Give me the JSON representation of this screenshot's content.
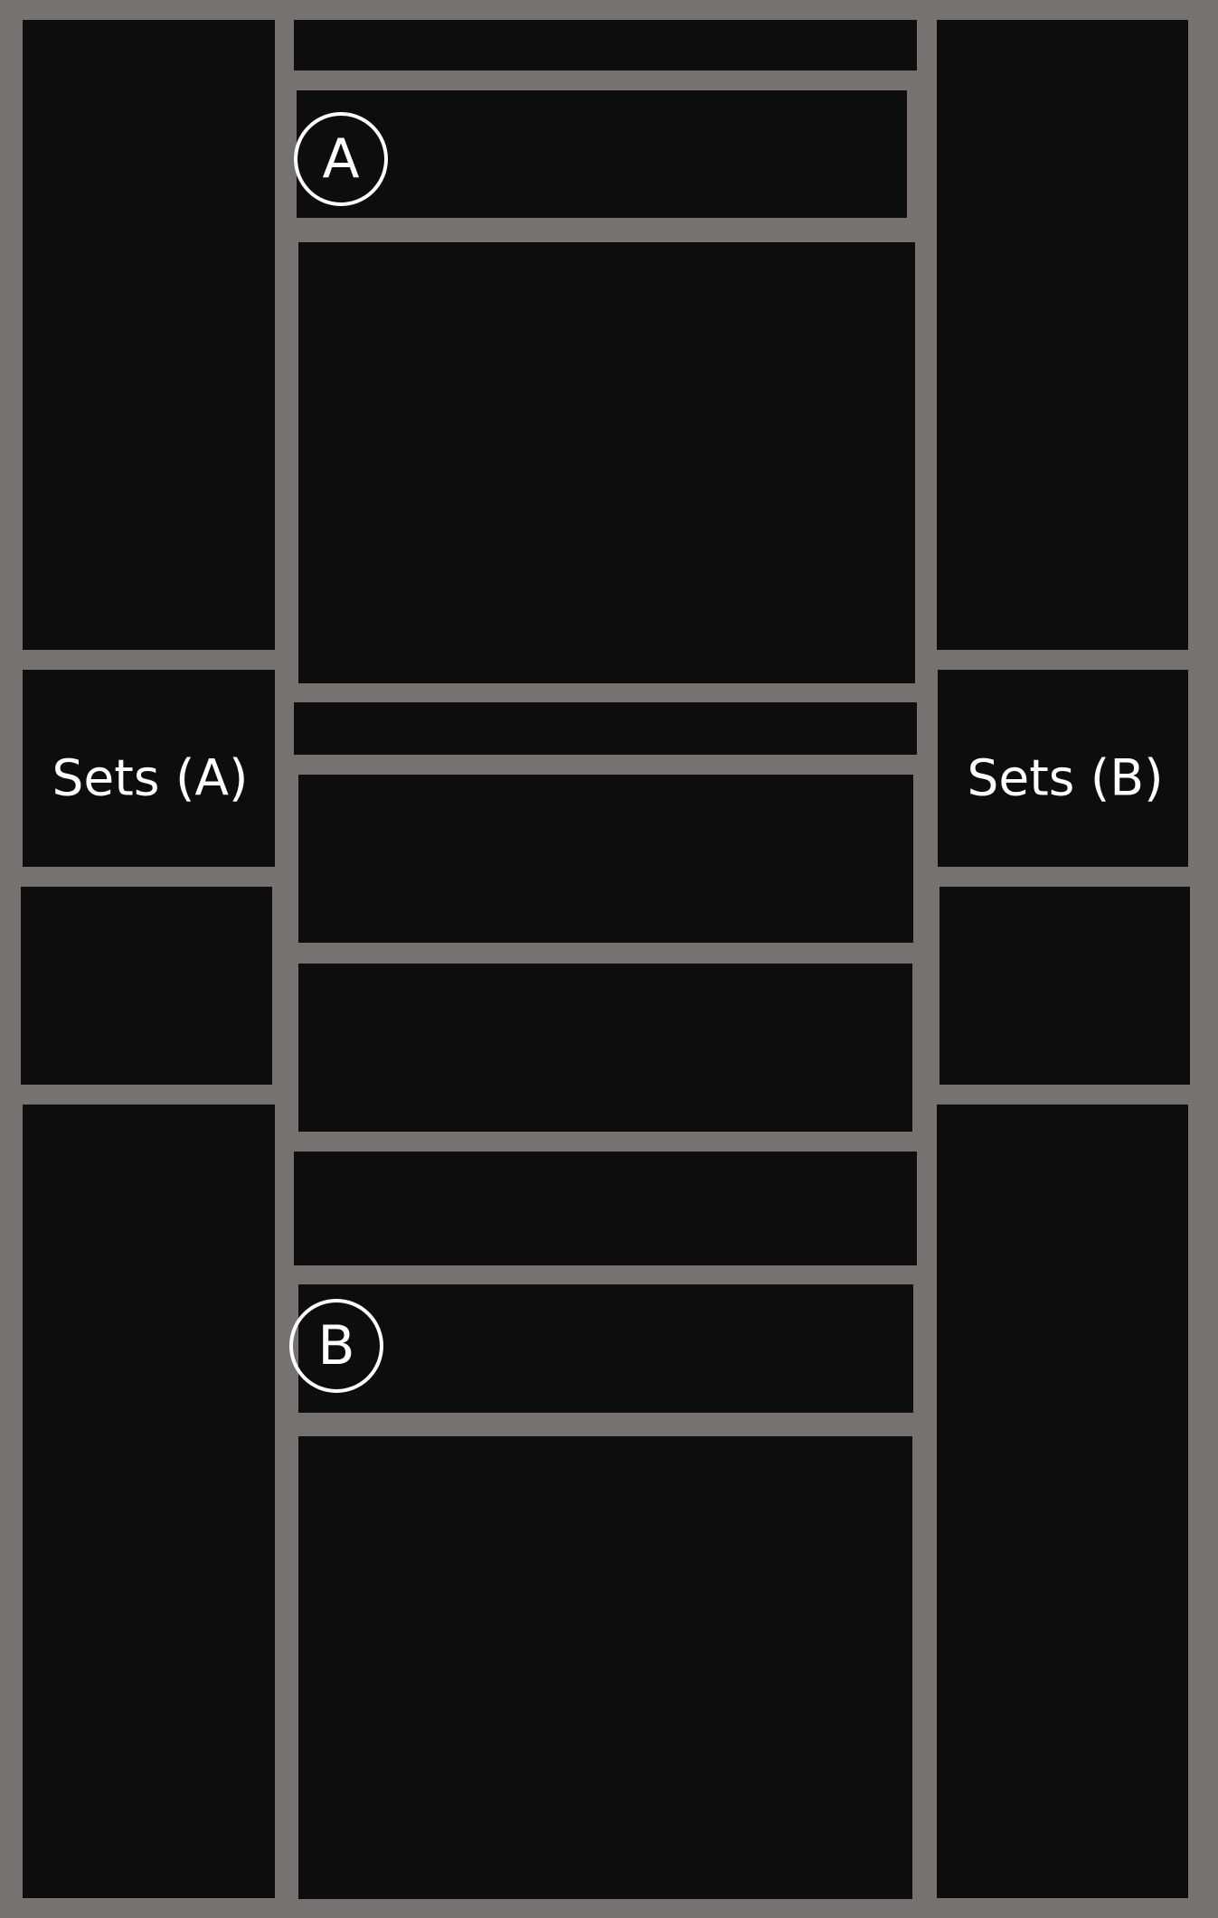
{
  "colors": {
    "frame": "#777270",
    "panel": "#0d0d0d",
    "text": "#ffffff"
  },
  "labels": {
    "sets_left": "Sets (A)",
    "sets_right": "Sets (B)"
  },
  "markers": {
    "a": "A",
    "b": "B"
  }
}
